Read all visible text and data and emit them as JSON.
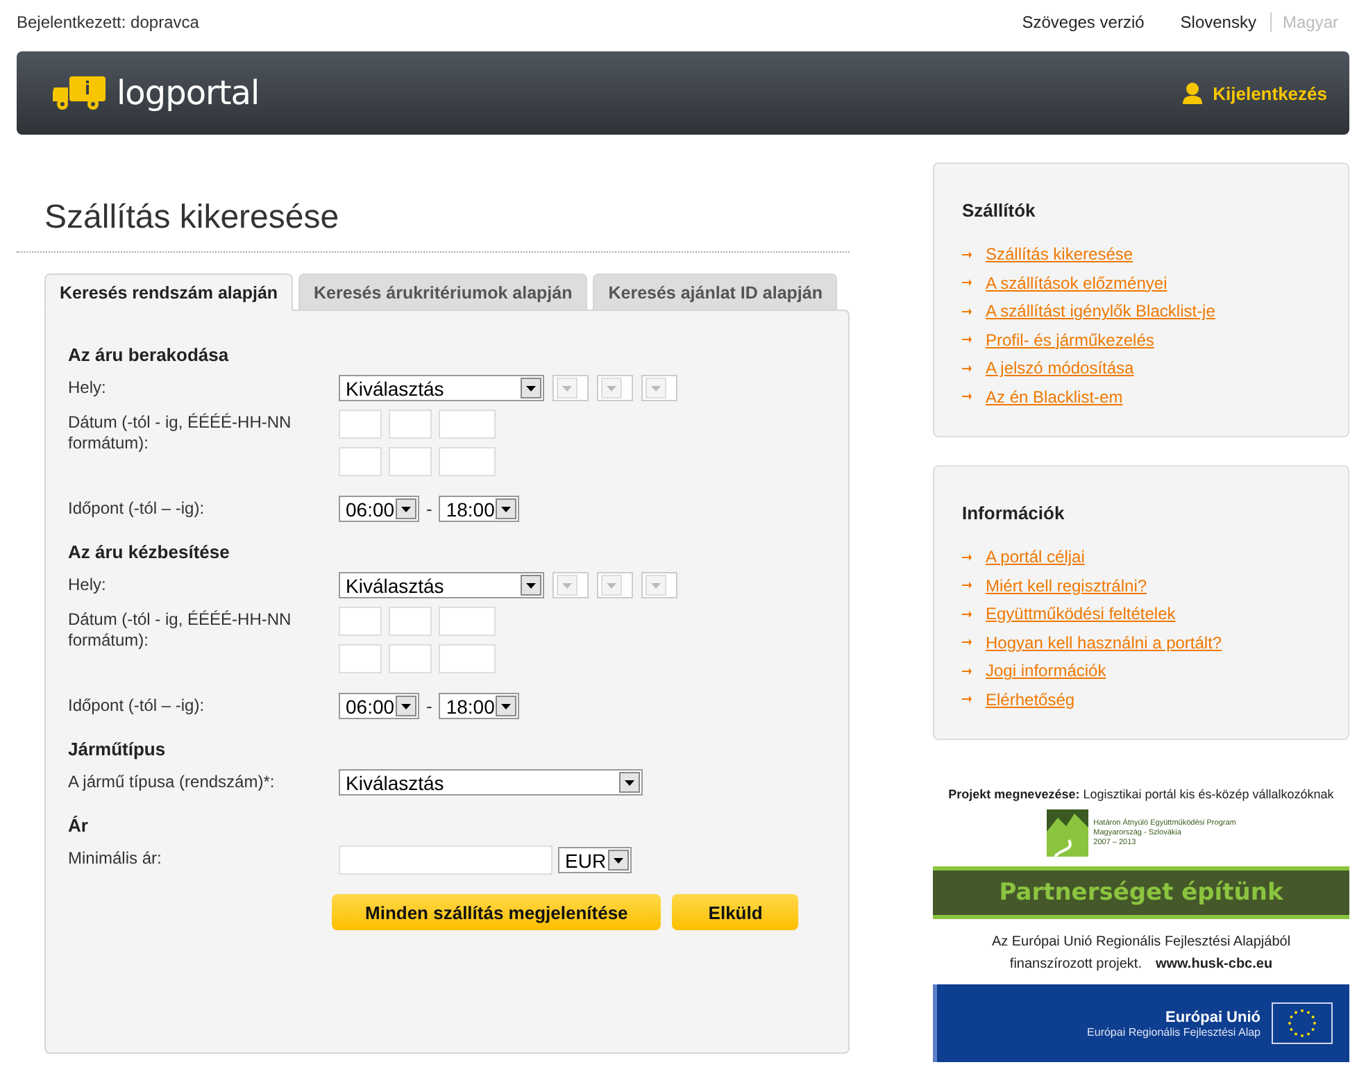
{
  "top_bar": {
    "user_label": "Bejelentkezett: dopravca",
    "text_version": "Szöveges verzió",
    "languages": [
      {
        "label": "Slovensky",
        "selected": false
      },
      {
        "label": "Magyar",
        "selected": true
      }
    ]
  },
  "header": {
    "logo": "logportal",
    "logout": "Kijelentkezés"
  },
  "page_title": "Szállítás kikeresése",
  "tabs": [
    {
      "label": "Keresés rendszám alapján",
      "selected": true
    },
    {
      "label": "Keresés árukritériumok alapján",
      "selected": false
    },
    {
      "label": "Keresés ajánlat ID alapján",
      "selected": false
    }
  ],
  "form": {
    "sections": [
      {
        "title": "Az áru berakodása",
        "rows": [
          {
            "kind": "place",
            "label": "Hely:",
            "value": "Kiválasztás",
            "subselects": [
              {
                "disabled": true
              },
              {
                "disabled": true
              },
              {
                "disabled": true
              }
            ]
          },
          {
            "kind": "date",
            "label": "Dátum (-tól - ig, ÉÉÉÉ-HH-NN formátum):"
          },
          {
            "kind": "time",
            "label": "Időpont (-tól – -ig):",
            "from": "06:00",
            "separator": "-",
            "to": "18:00"
          }
        ]
      },
      {
        "title": "Az áru kézbesítése",
        "rows": [
          {
            "kind": "place",
            "label": "Hely:",
            "value": "Kiválasztás",
            "subselects": [
              {
                "disabled": true
              },
              {
                "disabled": true
              },
              {
                "disabled": true
              }
            ]
          },
          {
            "kind": "date",
            "label": "Dátum (-tól - ig, ÉÉÉÉ-HH-NN formátum):"
          },
          {
            "kind": "time",
            "label": "Időpont (-tól – -ig):",
            "from": "06:00",
            "separator": "-",
            "to": "18:00"
          }
        ]
      },
      {
        "title": "Járműtípus",
        "rows": [
          {
            "kind": "select",
            "label": "A jármű típusa (rendszám)*:",
            "value": "Kiválasztás"
          }
        ]
      },
      {
        "title": "Ár",
        "rows": [
          {
            "kind": "price",
            "label": "Minimális ár:",
            "currency": "EUR"
          }
        ]
      }
    ],
    "buttons": [
      "Minden szállítás megjelenítése",
      "Elküld"
    ]
  },
  "sidebar": [
    {
      "title": "Szállítók",
      "links": [
        "Szállítás kikeresése",
        "A szállítások előzményei",
        "A szállítást igénylők Blacklist-je",
        "Profil- és járműkezelés",
        "A jelszó módosítása",
        "Az én Blacklist-em"
      ]
    },
    {
      "title": "Információk",
      "links": [
        "A portál céljai",
        "Miért kell regisztrálni?",
        "Együttműködési feltételek",
        "Hogyan kell használni a portált?",
        "Jogi információk",
        "Elérhetőség"
      ]
    }
  ],
  "banner": {
    "project": "**Projekt megnevezése:** Logisztikai portál kis és-közép vállalkozóknak",
    "program_lines": [
      "Határon Átnyúló Együttműködési Program",
      "Magyarország - Szlovákia",
      "2007 – 2013"
    ],
    "slogan": "Partnerséget építünk",
    "funding_lines": [
      "Az Európai Unió Regionális Fejlesztési Alapjából",
      "finanszírozott projekt."
    ],
    "website": "www.husk-cbc.eu",
    "eu_title": "Európai Unió",
    "eu_subtitle": "Európai Regionális Fejlesztési Alap"
  }
}
